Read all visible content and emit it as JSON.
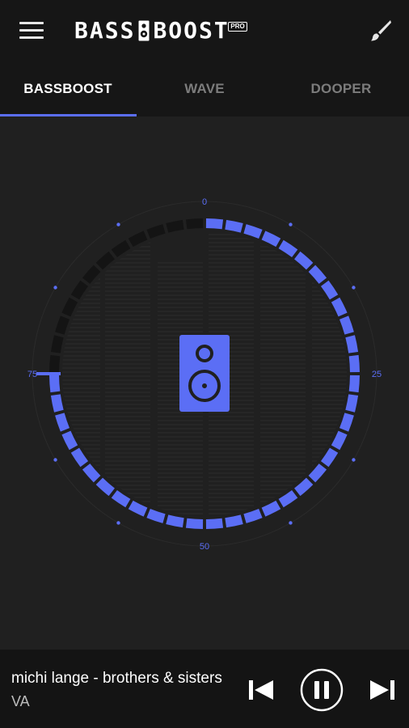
{
  "app": {
    "logo_left": "BASS",
    "logo_right": "BOOST",
    "logo_badge": "PRO"
  },
  "tabs": [
    {
      "label": "BASSBOOST",
      "active": true
    },
    {
      "label": "WAVE",
      "active": false
    },
    {
      "label": "DOOPER",
      "active": false
    }
  ],
  "dial": {
    "value": 75,
    "max": 100,
    "labels": {
      "top": "0",
      "right": "25",
      "bottom": "50",
      "left": "75"
    }
  },
  "player": {
    "title": "michi lange - brothers & sisters",
    "artist": "VA"
  },
  "colors": {
    "accent": "#5b6ef5",
    "background": "#161616",
    "panel": "#202020"
  },
  "icons": {
    "menu": "menu-icon",
    "brush": "brush-icon",
    "speaker": "speaker-icon",
    "previous": "skip-previous-icon",
    "pause": "pause-icon",
    "next": "skip-next-icon"
  }
}
